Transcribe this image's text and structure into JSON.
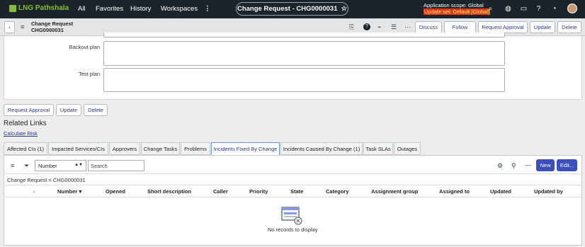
{
  "topnav": {
    "logo_text": "LNG Pathshala",
    "links": [
      "All",
      "Favorites",
      "History",
      "Workspaces"
    ],
    "title_pill": "Change Request - CHG0000031",
    "scope_line1": "Application scope: Global",
    "scope_line2": "Update set: Default [Global]"
  },
  "form_header": {
    "type": "Change Request",
    "number": "CHG0000031",
    "buttons": [
      "Discuss",
      "Follow",
      "Request Approval",
      "Update",
      "Delete"
    ]
  },
  "form": {
    "backout_plan_label": "Backout plan",
    "test_plan_label": "Test plan",
    "backout_plan_value": "",
    "test_plan_value": ""
  },
  "bottom_buttons": [
    "Request Approval",
    "Update",
    "Delete"
  ],
  "related": {
    "title": "Related Links",
    "calculate_risk": "Calculate Risk"
  },
  "tabs": [
    "Affected CIs (1)",
    "Impacted Services/CIs",
    "Approvers",
    "Change Tasks",
    "Problems",
    "Incidents Fixed By Change",
    "Incidents Caused By Change (1)",
    "Task SLAs",
    "Outages"
  ],
  "active_tab": "Incidents Fixed By Change",
  "list": {
    "search_field": "Number",
    "search_placeholder": "Search",
    "new_button": "New",
    "edit_button": "Edit...",
    "filter_text": "Change Request = CHG0000031",
    "columns": [
      "Number",
      "Opened",
      "Short description",
      "Caller",
      "Priority",
      "State",
      "Category",
      "Assignment group",
      "Assigned to",
      "Updated",
      "Updated by"
    ],
    "empty_message": "No records to display"
  },
  "colors": {
    "nav_bg": "#1b2428",
    "accent": "#3d4fb8",
    "logo_green": "#86bd3b",
    "warn": "#e03a1e"
  }
}
